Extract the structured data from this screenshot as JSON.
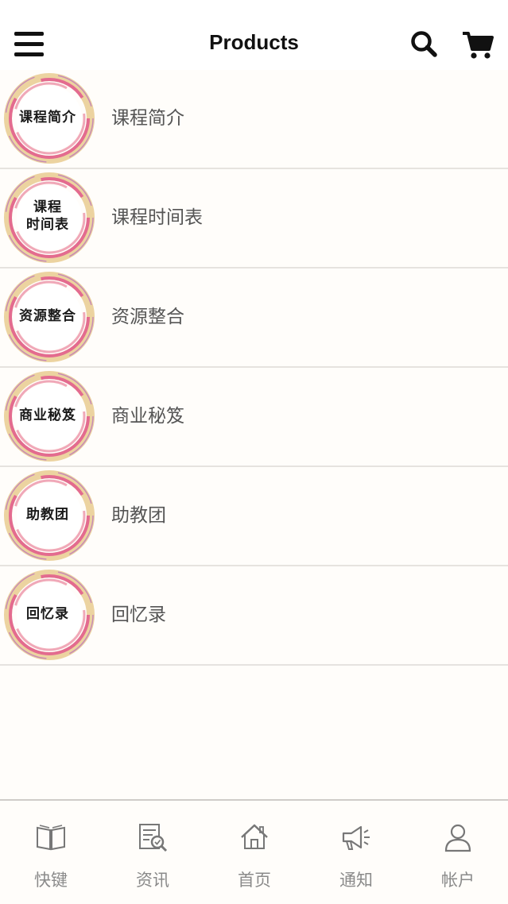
{
  "header": {
    "title": "Products",
    "menu_icon": "hamburger-menu-icon",
    "search_icon": "search-icon",
    "cart_icon": "shopping-cart-icon"
  },
  "list": {
    "items": [
      {
        "badge_lines": [
          "课程简介"
        ],
        "label": "课程简介"
      },
      {
        "badge_lines": [
          "课程",
          "时间表"
        ],
        "label": "课程时间表"
      },
      {
        "badge_lines": [
          "资源整合"
        ],
        "label": "资源整合"
      },
      {
        "badge_lines": [
          "商业秘笈"
        ],
        "label": "商业秘笈"
      },
      {
        "badge_lines": [
          "助教团"
        ],
        "label": "助教团"
      },
      {
        "badge_lines": [
          "回忆录"
        ],
        "label": "回忆录"
      }
    ]
  },
  "tabbar": {
    "tabs": [
      {
        "label": "快键",
        "icon": "book-icon"
      },
      {
        "label": "资讯",
        "icon": "news-icon"
      },
      {
        "label": "首页",
        "icon": "home-icon"
      },
      {
        "label": "通知",
        "icon": "megaphone-icon"
      },
      {
        "label": "帐户",
        "icon": "user-icon"
      }
    ]
  },
  "colors": {
    "background": "#fffdfa",
    "text_primary": "#111111",
    "text_secondary": "#555555",
    "tab_text": "#8a8a8a",
    "ring_pink": "#e0608a",
    "ring_gold": "#e9c98c"
  }
}
